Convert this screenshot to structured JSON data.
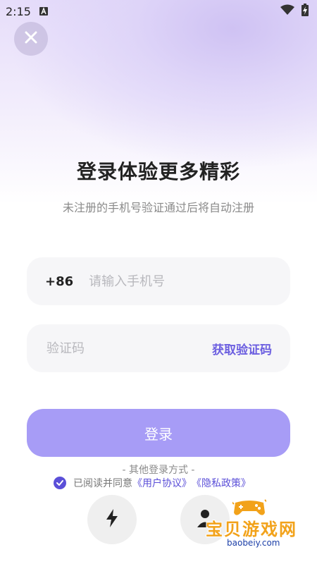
{
  "status_bar": {
    "time": "2:15",
    "icons": [
      "android-a-icon",
      "wifi-icon",
      "battery-charging-icon"
    ]
  },
  "header": {
    "close_icon": "close-icon",
    "title": "登录体验更多精彩",
    "subtitle": "未注册的手机号验证通过后将自动注册"
  },
  "form": {
    "country_code": "+86",
    "phone_placeholder": "请输入手机号",
    "phone_value": "",
    "code_placeholder": "验证码",
    "code_value": "",
    "get_code_label": "获取验证码",
    "login_label": "登录"
  },
  "other_login": {
    "label": "- 其他登录方式 -",
    "methods": [
      "lightning-icon",
      "person-icon"
    ]
  },
  "agreement": {
    "prefix": "已阅读并同意",
    "user_agreement": "《用户协议》",
    "privacy_policy": "《隐私政策》",
    "checked": true
  },
  "watermark": {
    "text": "宝贝游戏网",
    "domain": "baobeiy.com"
  },
  "colors": {
    "accent": "#5b4fd8",
    "login_button": "#a79cf6",
    "field_bg": "#f6f6f8"
  }
}
